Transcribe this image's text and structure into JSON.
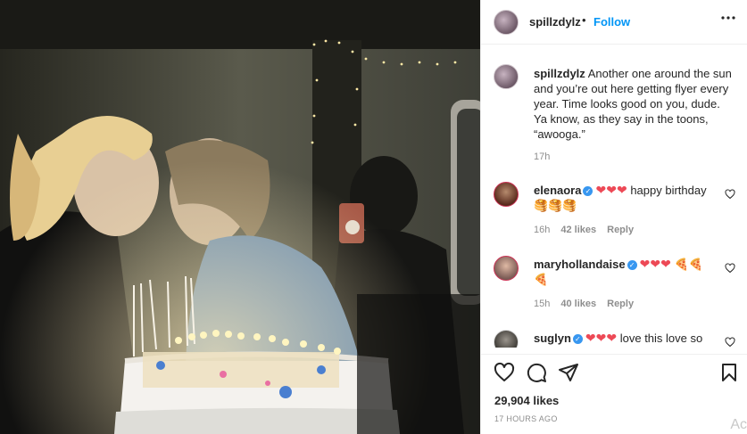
{
  "post": {
    "username": "spillzdylz",
    "dot": "•",
    "follow_label": "Follow",
    "more_label": "•••",
    "caption": "Another one around the sun and you’re out here getting flyer every year. Time looks good on you, dude. Ya know, as they say in the toons, “awooga.”",
    "caption_time": "17h",
    "likes": "29,904 likes",
    "posted_ago": "17 HOURS AGO",
    "watermark": "Ac"
  },
  "comments": [
    {
      "username": "elenaora",
      "text_after_hearts": "happy birthday",
      "hearts": "❤❤❤",
      "emoji_tail": "🥞🥞🥞",
      "time": "16h",
      "likes": "42 likes",
      "reply": "Reply"
    },
    {
      "username": "maryhollandaise",
      "text_after_hearts": "",
      "hearts": "❤❤❤",
      "emoji_tail": "🍕🍕🍕",
      "time": "15h",
      "likes": "40 likes",
      "reply": "Reply"
    },
    {
      "username": "suglyn",
      "text_after_hearts": "love this love so",
      "hearts": "❤❤❤",
      "emoji_tail": "",
      "time": "",
      "likes": "",
      "reply": ""
    }
  ],
  "icons": [
    "more-icon",
    "heart-icon",
    "comment-icon",
    "share-icon",
    "bookmark-icon",
    "verified-icon"
  ],
  "colors": {
    "follow": "#0095f6",
    "verified": "#3897f0",
    "heart": "#ed4956",
    "muted": "#8e8e8e"
  }
}
